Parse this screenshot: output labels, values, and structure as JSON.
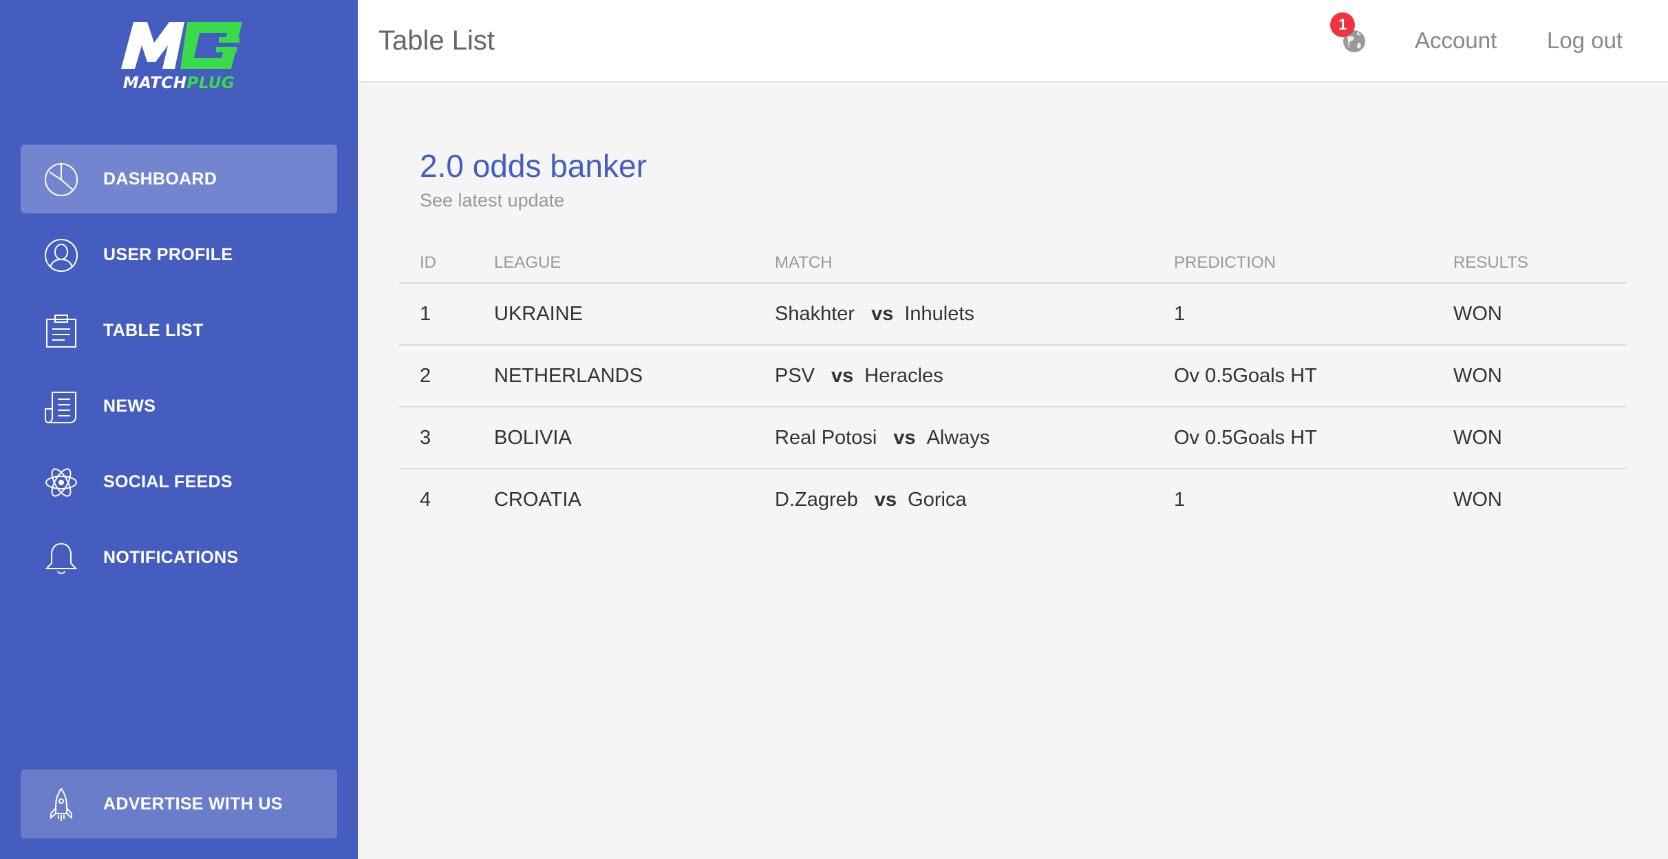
{
  "brand": {
    "logo_part1": "MATCH",
    "logo_part2": "PLUG",
    "colors": {
      "sidebar": "#445dbf",
      "accent_green": "#3adb4a",
      "badge_red": "#ef3340"
    }
  },
  "sidebar": {
    "items": [
      {
        "label": "DASHBOARD",
        "icon": "pie-chart-icon",
        "active": true
      },
      {
        "label": "USER PROFILE",
        "icon": "user-icon",
        "active": false
      },
      {
        "label": "TABLE LIST",
        "icon": "clipboard-icon",
        "active": false
      },
      {
        "label": "NEWS",
        "icon": "newspaper-icon",
        "active": false
      },
      {
        "label": "SOCIAL FEEDS",
        "icon": "atom-icon",
        "active": false
      },
      {
        "label": "NOTIFICATIONS",
        "icon": "bell-icon",
        "active": false
      }
    ],
    "footer_button": {
      "label": "ADVERTISE WITH US",
      "icon": "rocket-icon"
    }
  },
  "header": {
    "title": "Table List",
    "notification_count": "1",
    "notification_icon": "globe-icon",
    "account_label": "Account",
    "logout_label": "Log out"
  },
  "card": {
    "title": "2.0 odds banker",
    "subtitle": "See latest update",
    "columns": [
      "ID",
      "LEAGUE",
      "MATCH",
      "PREDICTION",
      "RESULTS"
    ],
    "rows": [
      {
        "id": "1",
        "league": "UKRAINE",
        "home": "Shakhter",
        "vs": "vs",
        "away": "Inhulets",
        "prediction": "1",
        "result": "WON"
      },
      {
        "id": "2",
        "league": "NETHERLANDS",
        "home": "PSV",
        "vs": "vs",
        "away": "Heracles",
        "prediction": "Ov 0.5Goals HT",
        "result": "WON"
      },
      {
        "id": "3",
        "league": "BOLIVIA",
        "home": "Real Potosi",
        "vs": "vs",
        "away": "Always",
        "prediction": "Ov 0.5Goals HT",
        "result": "WON"
      },
      {
        "id": "4",
        "league": "CROATIA",
        "home": "D.Zagreb",
        "vs": "vs",
        "away": "Gorica",
        "prediction": "1",
        "result": "WON"
      }
    ]
  }
}
